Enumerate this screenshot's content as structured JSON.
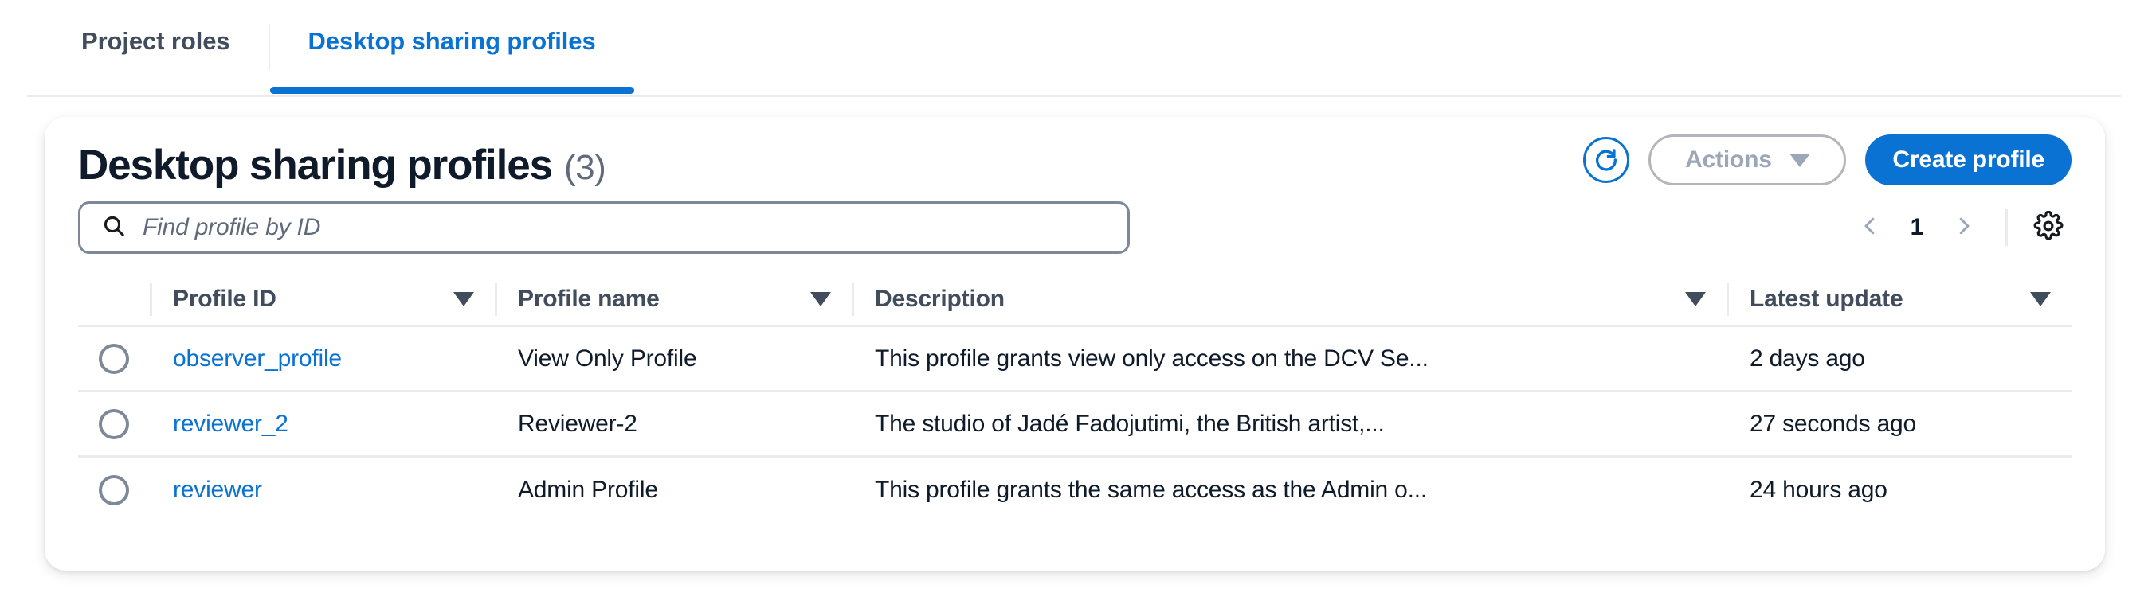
{
  "tabs": [
    {
      "label": "Project roles",
      "active": false
    },
    {
      "label": "Desktop sharing profiles",
      "active": true
    }
  ],
  "card": {
    "title": "Desktop sharing profiles",
    "count": "(3)",
    "refresh_icon": "refresh-icon",
    "actions_button": "Actions",
    "create_button": "Create profile",
    "search": {
      "icon": "search-icon",
      "placeholder": "Find profile by ID",
      "value": ""
    },
    "pagination": {
      "prev_icon": "chevron-left-icon",
      "page": "1",
      "next_icon": "chevron-right-icon",
      "settings_icon": "gear-icon"
    }
  },
  "table": {
    "columns": [
      {
        "key": "select",
        "label": "",
        "sortable": false
      },
      {
        "key": "id",
        "label": "Profile ID",
        "sortable": true
      },
      {
        "key": "name",
        "label": "Profile name",
        "sortable": true
      },
      {
        "key": "description",
        "label": "Description",
        "sortable": true
      },
      {
        "key": "updated",
        "label": "Latest update",
        "sortable": true
      }
    ],
    "rows": [
      {
        "id": "observer_profile",
        "name": "View Only Profile",
        "description": "This profile grants view only access on the DCV Se...",
        "updated": "2 days ago",
        "selected": false
      },
      {
        "id": "reviewer_2",
        "name": "Reviewer-2",
        "description": "The studio of Jadé Fadojutimi, the British artist,...",
        "updated": "27 seconds ago",
        "selected": false
      },
      {
        "id": "reviewer",
        "name": "Admin Profile",
        "description": "This profile grants the same access as the Admin o...",
        "updated": "24 hours ago",
        "selected": false
      }
    ]
  },
  "colors": {
    "accent_blue": "#0972d3",
    "text_dark": "#0f1b2a",
    "text_muted": "#5f6b7a",
    "border": "#e9ebed",
    "disabled": "#9ba7b6"
  }
}
